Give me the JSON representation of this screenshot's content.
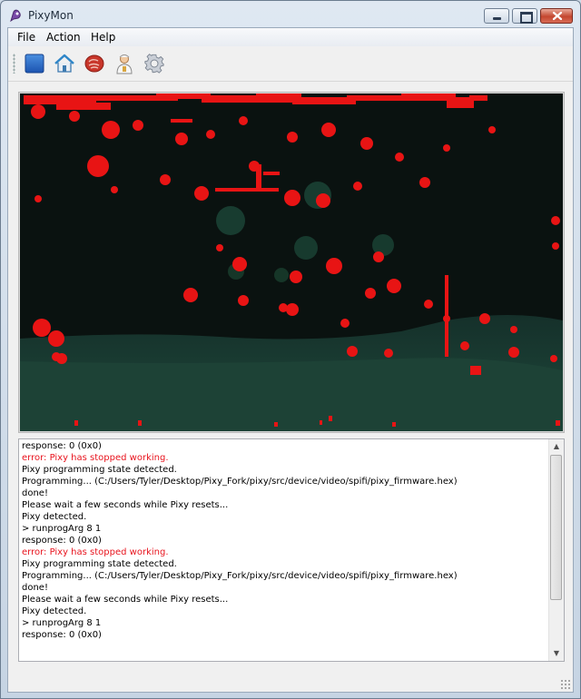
{
  "window": {
    "title": "PixyMon",
    "controls": [
      "minimize-icon",
      "maximize-icon",
      "close-icon"
    ]
  },
  "menu": {
    "items": [
      "File",
      "Action",
      "Help"
    ]
  },
  "toolbar": {
    "buttons": [
      {
        "name": "stop-icon",
        "tooltip": ""
      },
      {
        "name": "home-icon",
        "tooltip": ""
      },
      {
        "name": "raw-video-icon",
        "tooltip": ""
      },
      {
        "name": "configure-signatures-icon",
        "tooltip": ""
      },
      {
        "name": "settings-gear-icon",
        "tooltip": ""
      }
    ]
  },
  "colors": {
    "detection": "#e81414",
    "error_text": "#e8141e",
    "camera_dark": "#0a1210",
    "floor_teal": "#1e3a30"
  },
  "log": {
    "lines": [
      {
        "text": "response: 0 (0x0)",
        "error": false
      },
      {
        "text": "error: Pixy has stopped working.",
        "error": true
      },
      {
        "text": "Pixy programming state detected.",
        "error": false
      },
      {
        "text": "Programming... (C:/Users/Tyler/Desktop/Pixy_Fork/pixy/src/device/video/spifi/pixy_firmware.hex)",
        "error": false
      },
      {
        "text": "done!",
        "error": false
      },
      {
        "text": "Please wait a few seconds while Pixy resets...",
        "error": false
      },
      {
        "text": "Pixy detected.",
        "error": false
      },
      {
        "text": "> runprogArg 8 1",
        "error": false
      },
      {
        "text": "response: 0 (0x0)",
        "error": false
      },
      {
        "text": "error: Pixy has stopped working.",
        "error": true
      },
      {
        "text": "Pixy programming state detected.",
        "error": false
      },
      {
        "text": "Programming... (C:/Users/Tyler/Desktop/Pixy_Fork/pixy/src/device/video/spifi/pixy_firmware.hex)",
        "error": false
      },
      {
        "text": "done!",
        "error": false
      },
      {
        "text": "Please wait a few seconds while Pixy resets...",
        "error": false
      },
      {
        "text": "Pixy detected.",
        "error": false
      },
      {
        "text": "> runprogArg 8 1",
        "error": false
      },
      {
        "text": "response: 0 (0x0)",
        "error": false
      }
    ]
  }
}
